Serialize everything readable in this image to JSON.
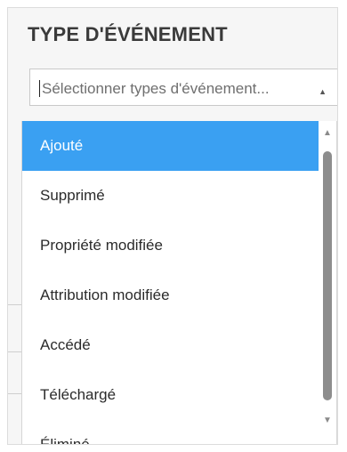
{
  "filter": {
    "title": "TYPE D'ÉVÉNEMENT",
    "placeholder": "Sélectionner types d'événement..."
  },
  "dropdown": {
    "options": [
      {
        "label": "Ajouté",
        "selected": true
      },
      {
        "label": "Supprimé",
        "selected": false
      },
      {
        "label": "Propriété modifiée",
        "selected": false
      },
      {
        "label": "Attribution modifiée",
        "selected": false
      },
      {
        "label": "Accédé",
        "selected": false
      },
      {
        "label": "Téléchargé",
        "selected": false
      },
      {
        "label": "Éliminé",
        "selected": false
      }
    ]
  },
  "colors": {
    "selected_background": "#3aa0f2",
    "panel_background": "#f6f6f6",
    "title_text": "#3a3a3a"
  },
  "icons": {
    "select_arrow": "chevron-up-icon",
    "scroll_up": "triangle-up-icon",
    "scroll_down": "triangle-down-icon"
  }
}
